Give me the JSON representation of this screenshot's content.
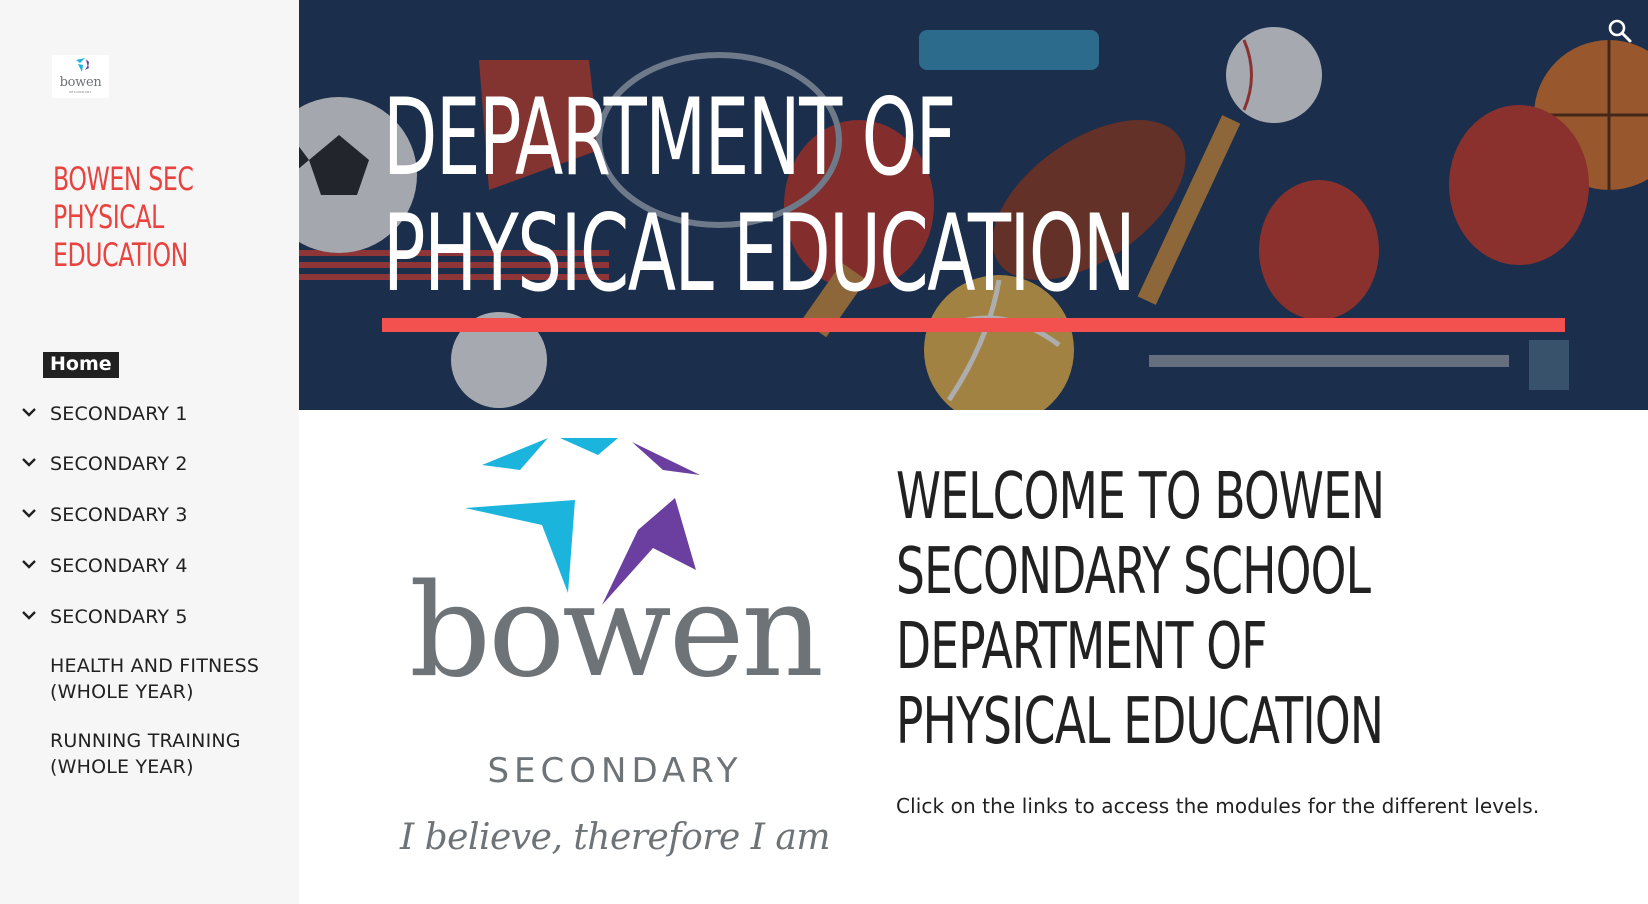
{
  "sidebar": {
    "logo": {
      "word": "bowen",
      "sub": "SECONDARY"
    },
    "site_title": "BOWEN SEC PHYSICAL EDUCATION",
    "nav": {
      "home": "Home",
      "items": [
        {
          "label": "SECONDARY 1",
          "expandable": true
        },
        {
          "label": "SECONDARY 2",
          "expandable": true
        },
        {
          "label": "SECONDARY 3",
          "expandable": true
        },
        {
          "label": "SECONDARY 4",
          "expandable": true
        },
        {
          "label": "SECONDARY 5",
          "expandable": true
        },
        {
          "label": "HEALTH AND FITNESS (WHOLE YEAR)",
          "expandable": false
        },
        {
          "label": "RUNNING TRAINING (WHOLE YEAR)",
          "expandable": false
        }
      ]
    }
  },
  "header": {
    "title": "DEPARTMENT OF PHYSICAL EDUCATION",
    "search_icon": "search-icon"
  },
  "main": {
    "logo": {
      "word": "bowen",
      "sub": "SECONDARY",
      "motto": "I believe, therefore I am"
    },
    "welcome_heading": "WELCOME TO BOWEN SECONDARY SCHOOL DEPARTMENT OF PHYSICAL EDUCATION",
    "intro_text": "Click on the links to access the modules for the different levels."
  },
  "colors": {
    "accent": "#e8433f",
    "hero_bar": "#f2514f",
    "sidebar_bg": "#f6f6f6",
    "hero_bg": "#1f3557",
    "logo_cyan": "#1ab4dc",
    "logo_purple": "#6b3fa0",
    "logo_grey": "#6d7377"
  }
}
